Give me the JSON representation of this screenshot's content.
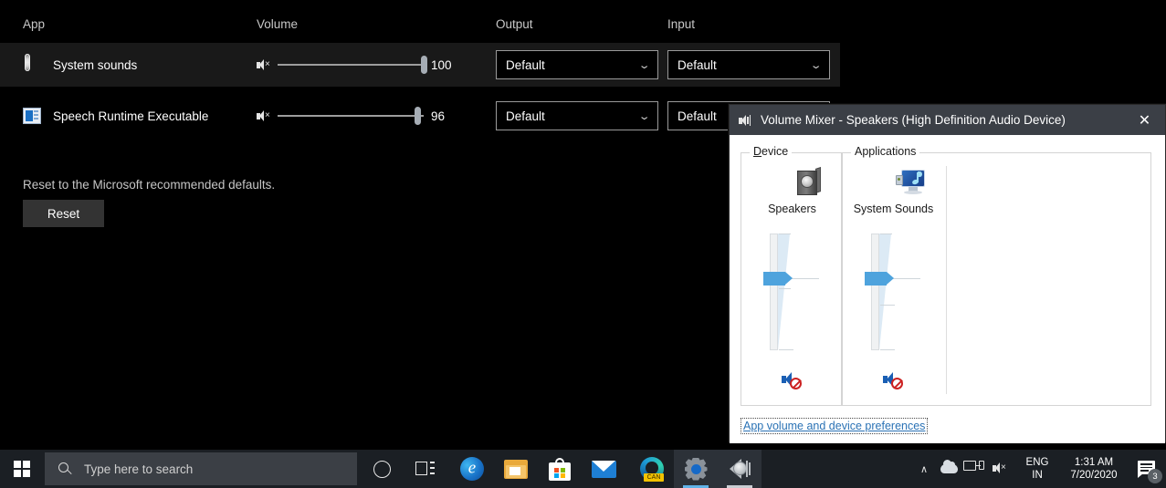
{
  "settings": {
    "columns": {
      "app": "App",
      "volume": "Volume",
      "output": "Output",
      "input": "Input"
    },
    "rows": [
      {
        "icon": "system-sounds-icon",
        "name": "System sounds",
        "mute_icon": "speaker-mute-icon",
        "volume": "100",
        "volume_percent": 100,
        "output": "Default",
        "input": "Default",
        "highlighted": true
      },
      {
        "icon": "speech-runtime-icon",
        "name": "Speech Runtime Executable",
        "mute_icon": "speaker-mute-icon",
        "volume": "96",
        "volume_percent": 96,
        "output": "Default",
        "input": "Default",
        "highlighted": false
      }
    ],
    "reset_description": "Reset to the Microsoft recommended defaults.",
    "reset_button": "Reset"
  },
  "volume_mixer": {
    "title": "Volume Mixer - Speakers (High Definition Audio Device)",
    "title_icon": "speaker-icon",
    "close_label": "✕",
    "groups": {
      "device_legend_accel": "D",
      "device_legend_rest": "evice",
      "applications_legend": "Applications"
    },
    "channels": [
      {
        "group": "device",
        "icon": "speakers-icon",
        "label": "Speakers",
        "slider_percent": 50,
        "mute_icon": "mute-speaker-icon",
        "muted": true
      },
      {
        "group": "applications",
        "icon": "system-sounds-monitor-icon",
        "label": "System Sounds",
        "slider_percent": 50,
        "mute_icon": "mute-speaker-icon",
        "muted": true
      }
    ],
    "link": "App volume and device preferences"
  },
  "taskbar": {
    "start_icon": "windows-logo-icon",
    "search_placeholder": "Type here to search",
    "search_icon": "search-icon",
    "items": [
      {
        "name": "cortana-icon",
        "label": "Cortana",
        "active": false,
        "underline": "none"
      },
      {
        "name": "task-view-icon",
        "label": "Task View",
        "active": false,
        "underline": "none"
      },
      {
        "name": "edge-icon",
        "label": "Microsoft Edge",
        "active": false,
        "underline": "none"
      },
      {
        "name": "file-explorer-icon",
        "label": "File Explorer",
        "active": false,
        "underline": "none"
      },
      {
        "name": "microsoft-store-icon",
        "label": "Microsoft Store",
        "active": false,
        "underline": "none"
      },
      {
        "name": "mail-icon",
        "label": "Mail",
        "active": false,
        "underline": "none"
      },
      {
        "name": "edge-canary-icon",
        "label": "Edge Canary",
        "badge": "CAN",
        "active": false,
        "underline": "none"
      },
      {
        "name": "settings-icon",
        "label": "Settings",
        "active": true,
        "underline": "blue"
      },
      {
        "name": "volume-mixer-icon",
        "label": "Volume Mixer",
        "active": true,
        "underline": "grey"
      }
    ],
    "tray": {
      "chevron": "∧",
      "cloud_icon": "onedrive-icon",
      "network_icon": "network-icon",
      "volume_icon": "volume-mute-icon",
      "language_top": "ENG",
      "language_bottom": "IN",
      "time": "1:31 AM",
      "date": "7/20/2020",
      "notification_icon": "action-center-icon",
      "notification_count": "3"
    }
  },
  "colors": {
    "page_bg": "#000000",
    "row_highlight": "#191919",
    "accent_blue": "#4ea3dd",
    "link_blue": "#2a72b5",
    "taskbar_bg": "#1b1f24",
    "titlebar_bg": "#3b3f46",
    "mute_red": "#cc2222"
  }
}
